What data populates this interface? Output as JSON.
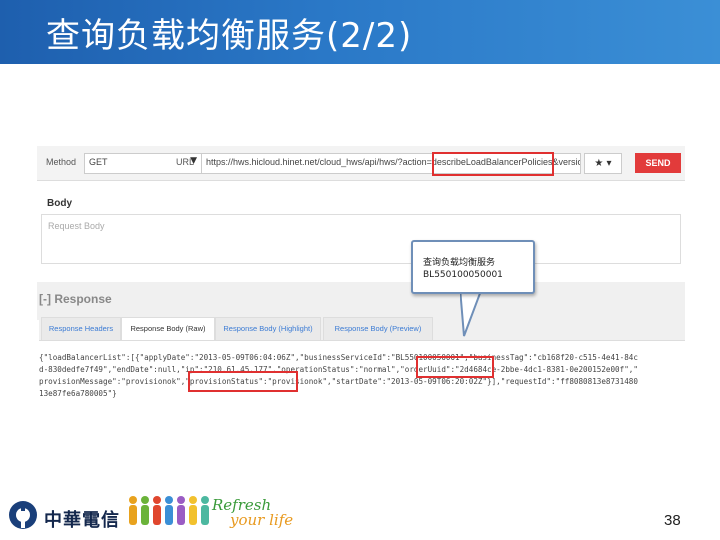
{
  "slide": {
    "title": "查询负载均衡服务(2/2)",
    "page_number": "38",
    "colors": {
      "title_bar": "#2a78c7",
      "highlight": "#e03030",
      "send": "#e23b3b"
    }
  },
  "request": {
    "method_label": "Method",
    "method_value": "GET",
    "url_label": "URL",
    "url_value": "https://hws.hicloud.hinet.net/cloud_hws/api/hws/?action=describeLoadBalancerPolicies&versio",
    "send_label": "SEND",
    "star_icon": "★",
    "body_label": "Body",
    "body_placeholder": "Request Body"
  },
  "response": {
    "title": "[-] Response",
    "tabs": [
      {
        "label": "Response Headers",
        "active": false
      },
      {
        "label": "Response Body (Raw)",
        "active": true
      },
      {
        "label": "Response Body (Highlight)",
        "active": false
      },
      {
        "label": "Response Body (Preview)",
        "active": false
      }
    ],
    "body_lines": [
      "{\"loadBalancerList\":[{\"applyDate\":\"2013-05-09T06:04:06Z\",\"businessServiceId\":\"BL550100050001\",\"businessTag\":\"cb168f20-c515-4e41-84c",
      "d-830dedfe7f49\",\"endDate\":null,\"ip\":\"210.61.45.177\",\"operationStatus\":\"normal\",\"orderUuid\":\"2d4684ce-2bbe-4dc1-8381-0e200152e00f\",\"",
      "provisionMessage\":\"provisionok\",\"provisionStatus\":\"provisionok\",\"startDate\":\"2013-05-09T06:20:02Z\"}],\"requestId\":\"ff8080813e8731480",
      "13e87fe6a780005\"}"
    ]
  },
  "callout": {
    "line1": "查询负载均衡服务",
    "line2": "BL550100050001"
  },
  "footer": {
    "company": "中華電信",
    "slogan_line1": "Refresh",
    "slogan_line2": "your life"
  }
}
